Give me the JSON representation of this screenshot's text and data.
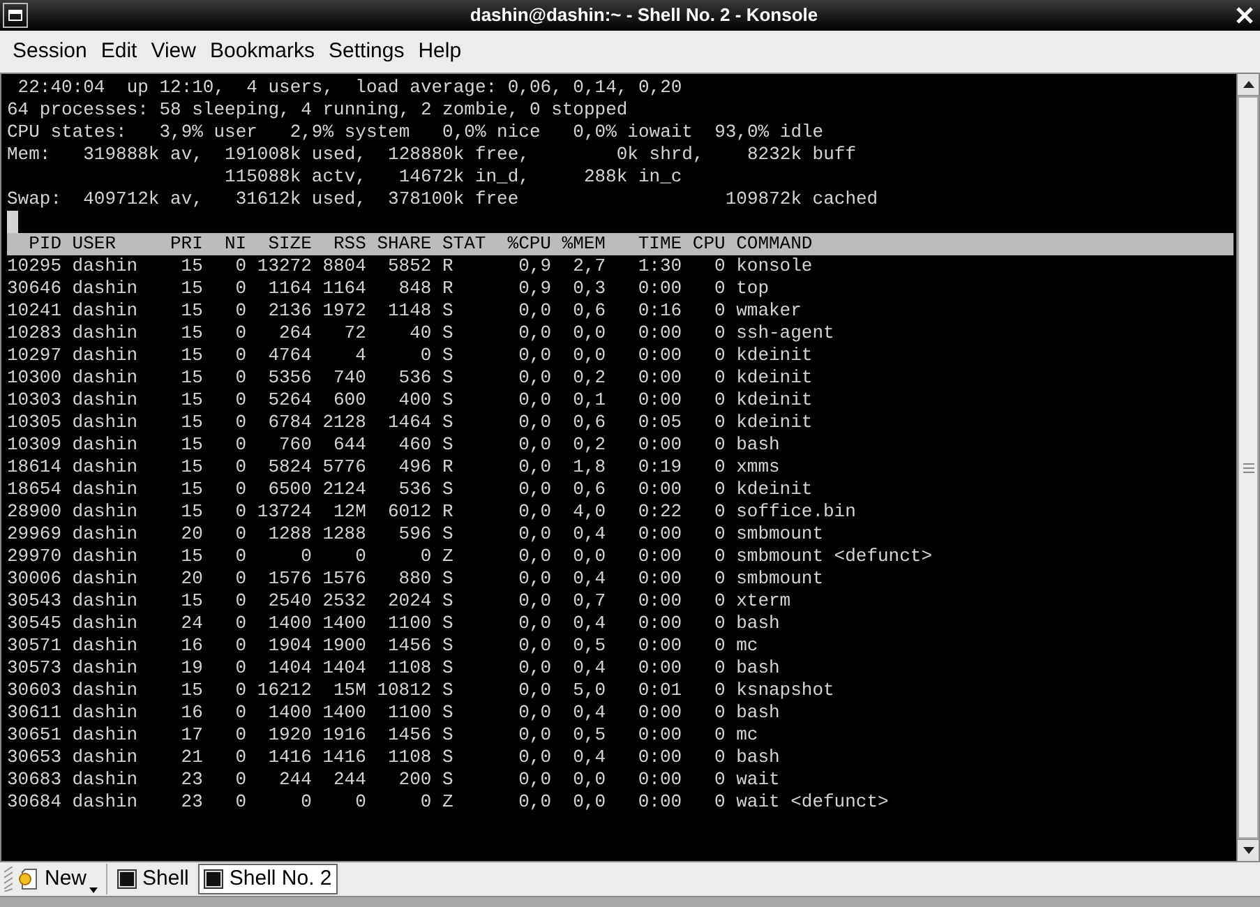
{
  "window": {
    "title": "dashin@dashin:~ - Shell No. 2 - Konsole"
  },
  "menu": [
    "Session",
    "Edit",
    "View",
    "Bookmarks",
    "Settings",
    "Help"
  ],
  "terminal": {
    "summary_lines": [
      {
        "kind": "plain",
        "text": " 22:40:04  up 12:10,  4 users,  load average: 0,06, 0,14, 0,20"
      },
      {
        "kind": "plain",
        "text": "64 processes: 58 sleeping, 4 running, 2 zombie, 0 stopped"
      },
      {
        "kind": "plain",
        "text": "CPU states:   3,9% user   2,9% system   0,0% nice   0,0% iowait  93,0% idle"
      },
      {
        "kind": "plain",
        "text": "Mem:   319888k av,  191008k used,  128880k free,        0k shrd,    8232k buff"
      },
      {
        "kind": "continuation",
        "text": "115088k actv,   14672k in_d,     288k in_c"
      },
      {
        "kind": "plain",
        "text": "Swap:  409712k av,   31612k used,  378100k free                   109872k cached"
      }
    ],
    "columns": [
      "PID",
      "USER",
      "PRI",
      "NI",
      "SIZE",
      "RSS",
      "SHARE",
      "STAT",
      "%CPU",
      "%MEM",
      "TIME",
      "CPU",
      "COMMAND"
    ],
    "rows": [
      [
        "10295",
        "dashin",
        "15",
        "0",
        "13272",
        "8804",
        "5852",
        "R",
        "0,9",
        "2,7",
        "1:30",
        "0",
        "konsole"
      ],
      [
        "30646",
        "dashin",
        "15",
        "0",
        "1164",
        "1164",
        "848",
        "R",
        "0,9",
        "0,3",
        "0:00",
        "0",
        "top"
      ],
      [
        "10241",
        "dashin",
        "15",
        "0",
        "2136",
        "1972",
        "1148",
        "S",
        "0,0",
        "0,6",
        "0:16",
        "0",
        "wmaker"
      ],
      [
        "10283",
        "dashin",
        "15",
        "0",
        "264",
        "72",
        "40",
        "S",
        "0,0",
        "0,0",
        "0:00",
        "0",
        "ssh-agent"
      ],
      [
        "10297",
        "dashin",
        "15",
        "0",
        "4764",
        "4",
        "0",
        "S",
        "0,0",
        "0,0",
        "0:00",
        "0",
        "kdeinit"
      ],
      [
        "10300",
        "dashin",
        "15",
        "0",
        "5356",
        "740",
        "536",
        "S",
        "0,0",
        "0,2",
        "0:00",
        "0",
        "kdeinit"
      ],
      [
        "10303",
        "dashin",
        "15",
        "0",
        "5264",
        "600",
        "400",
        "S",
        "0,0",
        "0,1",
        "0:00",
        "0",
        "kdeinit"
      ],
      [
        "10305",
        "dashin",
        "15",
        "0",
        "6784",
        "2128",
        "1464",
        "S",
        "0,0",
        "0,6",
        "0:05",
        "0",
        "kdeinit"
      ],
      [
        "10309",
        "dashin",
        "15",
        "0",
        "760",
        "644",
        "460",
        "S",
        "0,0",
        "0,2",
        "0:00",
        "0",
        "bash"
      ],
      [
        "18614",
        "dashin",
        "15",
        "0",
        "5824",
        "5776",
        "496",
        "R",
        "0,0",
        "1,8",
        "0:19",
        "0",
        "xmms"
      ],
      [
        "18654",
        "dashin",
        "15",
        "0",
        "6500",
        "2124",
        "536",
        "S",
        "0,0",
        "0,6",
        "0:00",
        "0",
        "kdeinit"
      ],
      [
        "28900",
        "dashin",
        "15",
        "0",
        "13724",
        "12M",
        "6012",
        "R",
        "0,0",
        "4,0",
        "0:22",
        "0",
        "soffice.bin"
      ],
      [
        "29969",
        "dashin",
        "20",
        "0",
        "1288",
        "1288",
        "596",
        "S",
        "0,0",
        "0,4",
        "0:00",
        "0",
        "smbmount"
      ],
      [
        "29970",
        "dashin",
        "15",
        "0",
        "0",
        "0",
        "0",
        "Z",
        "0,0",
        "0,0",
        "0:00",
        "0",
        "smbmount <defunct>"
      ],
      [
        "30006",
        "dashin",
        "20",
        "0",
        "1576",
        "1576",
        "880",
        "S",
        "0,0",
        "0,4",
        "0:00",
        "0",
        "smbmount"
      ],
      [
        "30543",
        "dashin",
        "15",
        "0",
        "2540",
        "2532",
        "2024",
        "S",
        "0,0",
        "0,7",
        "0:00",
        "0",
        "xterm"
      ],
      [
        "30545",
        "dashin",
        "24",
        "0",
        "1400",
        "1400",
        "1100",
        "S",
        "0,0",
        "0,4",
        "0:00",
        "0",
        "bash"
      ],
      [
        "30571",
        "dashin",
        "16",
        "0",
        "1904",
        "1900",
        "1456",
        "S",
        "0,0",
        "0,5",
        "0:00",
        "0",
        "mc"
      ],
      [
        "30573",
        "dashin",
        "19",
        "0",
        "1404",
        "1404",
        "1108",
        "S",
        "0,0",
        "0,4",
        "0:00",
        "0",
        "bash"
      ],
      [
        "30603",
        "dashin",
        "15",
        "0",
        "16212",
        "15M",
        "10812",
        "S",
        "0,0",
        "5,0",
        "0:01",
        "0",
        "ksnapshot"
      ],
      [
        "30611",
        "dashin",
        "16",
        "0",
        "1400",
        "1400",
        "1100",
        "S",
        "0,0",
        "0,4",
        "0:00",
        "0",
        "bash"
      ],
      [
        "30651",
        "dashin",
        "17",
        "0",
        "1920",
        "1916",
        "1456",
        "S",
        "0,0",
        "0,5",
        "0:00",
        "0",
        "mc"
      ],
      [
        "30653",
        "dashin",
        "21",
        "0",
        "1416",
        "1416",
        "1108",
        "S",
        "0,0",
        "0,4",
        "0:00",
        "0",
        "bash"
      ],
      [
        "30683",
        "dashin",
        "23",
        "0",
        "244",
        "244",
        "200",
        "S",
        "0,0",
        "0,0",
        "0:00",
        "0",
        "wait"
      ],
      [
        "30684",
        "dashin",
        "23",
        "0",
        "0",
        "0",
        "0",
        "Z",
        "0,0",
        "0,0",
        "0:00",
        "0",
        "wait <defunct>"
      ]
    ]
  },
  "toolbar": {
    "new_button": "New"
  },
  "tabs": [
    {
      "label": "Shell",
      "selected": false
    },
    {
      "label": "Shell No. 2",
      "selected": true
    }
  ]
}
